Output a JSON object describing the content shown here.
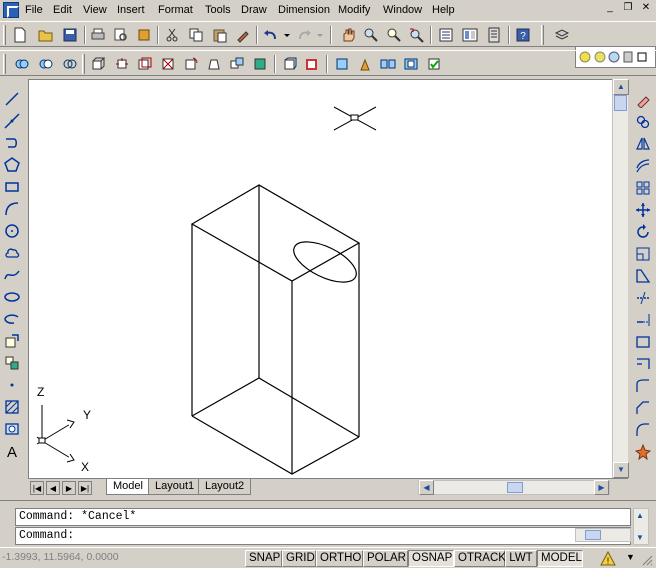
{
  "menu": {
    "items": [
      "File",
      "Edit",
      "View",
      "Insert",
      "Format",
      "Tools",
      "Draw",
      "Dimension",
      "Modify",
      "Window",
      "Help"
    ],
    "window_controls": {
      "minimize": "_",
      "restore": "❐",
      "close": "✕"
    }
  },
  "toolbars": {
    "standard": [
      "new-icon",
      "open-icon",
      "save-icon",
      "print-icon",
      "plot-preview-icon",
      "publish-icon",
      "cut-icon",
      "copy-icon",
      "paste-icon",
      "match-properties-icon",
      "undo-icon",
      "redo-icon",
      "pan-icon",
      "zoom-realtime-icon",
      "zoom-window-icon",
      "zoom-previous-icon",
      "properties-icon",
      "design-center-icon",
      "tool-palettes-icon",
      "help-icon"
    ],
    "layers": [
      "layer-properties-icon",
      "layer-state-icon"
    ],
    "solids_editing": [
      "union-icon",
      "subtract-icon",
      "intersect-icon"
    ],
    "solids": [
      "extrude-faces-icon",
      "move-faces-icon",
      "offset-faces-icon",
      "delete-faces-icon",
      "rotate-faces-icon",
      "taper-faces-icon",
      "copy-faces-icon",
      "color-faces-icon",
      "copy-edges-icon",
      "color-edges-icon",
      "imprint-icon",
      "clean-icon",
      "separate-icon",
      "shell-icon",
      "check-icon"
    ]
  },
  "draw_toolbar": [
    "line-icon",
    "construction-line-icon",
    "polyline-icon",
    "polygon-icon",
    "rectangle-icon",
    "arc-icon",
    "circle-icon",
    "revision-cloud-icon",
    "spline-icon",
    "ellipse-icon",
    "ellipse-arc-icon",
    "insert-block-icon",
    "make-block-icon",
    "point-icon",
    "hatch-icon",
    "region-icon",
    "multiline-text-icon"
  ],
  "modify_toolbar": [
    "erase-icon",
    "copy-object-icon",
    "mirror-icon",
    "offset-icon",
    "array-icon",
    "move-icon",
    "rotate-icon",
    "scale-icon",
    "stretch-icon",
    "trim-icon",
    "extend-icon",
    "break-at-point-icon",
    "break-icon",
    "join-icon",
    "chamfer-icon",
    "fillet-icon",
    "explode-icon"
  ],
  "ucs": {
    "x": "X",
    "y": "Y",
    "z": "Z"
  },
  "layout_tabs": [
    "Model",
    "Layout1",
    "Layout2"
  ],
  "active_tab": "Model",
  "command": {
    "history": "Command: *Cancel*",
    "prompt": "Command:"
  },
  "status": {
    "coordinates": "-1.3993, 11.5964, 0.0000",
    "buttons": [
      "SNAP",
      "GRID",
      "ORTHO",
      "POLAR",
      "OSNAP",
      "OTRACK",
      "LWT",
      "MODEL"
    ],
    "active": [
      "OSNAP",
      "MODEL"
    ]
  },
  "colors": {
    "background": "#d4d0c8",
    "canvas": "#ffffff",
    "accent": "#2a62b8"
  }
}
